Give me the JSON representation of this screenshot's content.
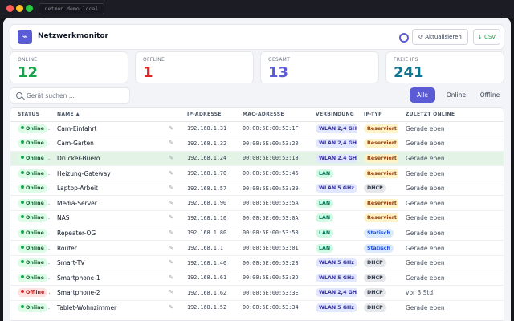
{
  "window": {
    "url": "netmon.demo.local"
  },
  "header": {
    "title": "Netzwerkmonitor",
    "refresh_label": "⟳ Aktualisieren",
    "csv_label": "↓ CSV"
  },
  "stats": [
    {
      "label": "ONLINE",
      "value": "12",
      "color": "#16a34a"
    },
    {
      "label": "OFFLINE",
      "value": "1",
      "color": "#dc2626"
    },
    {
      "label": "GESAMT",
      "value": "13",
      "color": "#5b5bd6"
    },
    {
      "label": "FREIE IPS",
      "value": "241",
      "color": "#0e7490"
    }
  ],
  "search": {
    "placeholder": "Gerät suchen ..."
  },
  "filters": [
    "Alle",
    "Online",
    "Offline"
  ],
  "table": {
    "columns": [
      "STATUS",
      "NAME ▲",
      "IP-ADRESSE",
      "MAC-ADRESSE",
      "VERBINDUNG",
      "IP-TYP",
      "ZULETZT ONLINE"
    ],
    "rows": [
      {
        "status": "Online",
        "name": "Cam-Einfahrt",
        "ip": "192.168.1.31",
        "mac": "00:00:5E:00:53:1F",
        "conn": "WLAN 2,4 GHz",
        "iptype": "Reserviert",
        "seen": "Gerade eben"
      },
      {
        "status": "Online",
        "name": "Cam-Garten",
        "ip": "192.168.1.32",
        "mac": "00:00:5E:00:53:20",
        "conn": "WLAN 2,4 GHz",
        "iptype": "Reserviert",
        "seen": "Gerade eben"
      },
      {
        "status": "Online",
        "name": "Drucker-Buero",
        "ip": "192.168.1.24",
        "mac": "00:00:5E:00:53:18",
        "conn": "WLAN 2,4 GHz",
        "iptype": "Reserviert",
        "seen": "Gerade eben"
      },
      {
        "status": "Online",
        "name": "Heizung-Gateway",
        "ip": "192.168.1.70",
        "mac": "00:00:5E:00:53:46",
        "conn": "LAN",
        "iptype": "Reserviert",
        "seen": "Gerade eben"
      },
      {
        "status": "Online",
        "name": "Laptop-Arbeit",
        "ip": "192.168.1.57",
        "mac": "00:00:5E:00:53:39",
        "conn": "WLAN 5 GHz",
        "iptype": "DHCP",
        "seen": "Gerade eben"
      },
      {
        "status": "Online",
        "name": "Media-Server",
        "ip": "192.168.1.90",
        "mac": "00:00:5E:00:53:5A",
        "conn": "LAN",
        "iptype": "Reserviert",
        "seen": "Gerade eben"
      },
      {
        "status": "Online",
        "name": "NAS",
        "ip": "192.168.1.10",
        "mac": "00:00:5E:00:53:0A",
        "conn": "LAN",
        "iptype": "Reserviert",
        "seen": "Gerade eben"
      },
      {
        "status": "Online",
        "name": "Repeater-OG",
        "ip": "192.168.1.80",
        "mac": "00:00:5E:00:53:50",
        "conn": "LAN",
        "iptype": "Statisch",
        "seen": "Gerade eben"
      },
      {
        "status": "Online",
        "name": "Router",
        "ip": "192.168.1.1",
        "mac": "00:00:5E:00:53:01",
        "conn": "LAN",
        "iptype": "Statisch",
        "seen": "Gerade eben"
      },
      {
        "status": "Online",
        "name": "Smart-TV",
        "ip": "192.168.1.40",
        "mac": "00:00:5E:00:53:28",
        "conn": "WLAN 5 GHz",
        "iptype": "DHCP",
        "seen": "Gerade eben"
      },
      {
        "status": "Online",
        "name": "Smartphone-1",
        "ip": "192.168.1.61",
        "mac": "00:00:5E:00:53:3D",
        "conn": "WLAN 5 GHz",
        "iptype": "DHCP",
        "seen": "Gerade eben"
      },
      {
        "status": "Offline",
        "name": "Smartphone-2",
        "ip": "192.168.1.62",
        "mac": "00:00:5E:00:53:3E",
        "conn": "WLAN 2,4 GHz",
        "iptype": "DHCP",
        "seen": "vor 3 Std."
      },
      {
        "status": "Online",
        "name": "Tablet-Wohnzimmer",
        "ip": "192.168.1.52",
        "mac": "00:00:5E:00:53:34",
        "conn": "WLAN 5 GHz",
        "iptype": "DHCP",
        "seen": "Gerade eben"
      }
    ]
  }
}
